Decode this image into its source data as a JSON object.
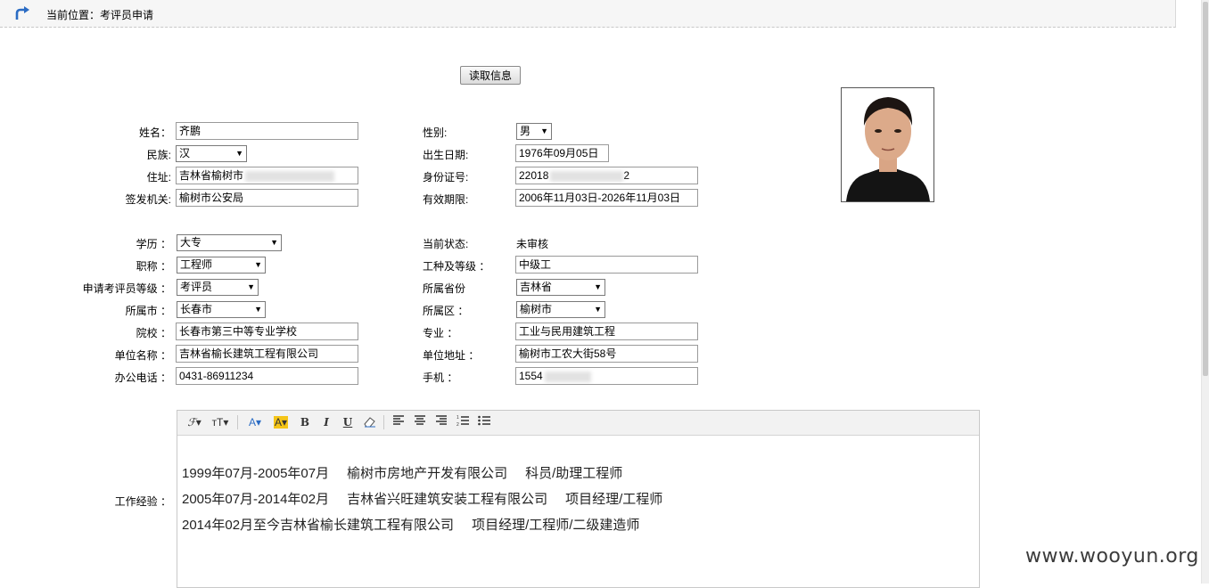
{
  "breadcrumb": {
    "text": "当前位置：考评员申请"
  },
  "read_button": {
    "label": "读取信息"
  },
  "identity": {
    "name_label": "姓名：",
    "name_value": "齐鹏",
    "gender_label": "性别:",
    "gender_value": "男",
    "ethnicity_label": "民族:",
    "ethnicity_value": "汉",
    "birth_label": "出生日期:",
    "birth_value": "1976年09月05日",
    "address_label": "住址:",
    "address_value": "吉林省榆树市",
    "idnum_label": "身份证号:",
    "idnum_prefix": "22018",
    "idnum_suffix": "2",
    "issuer_label": "签发机关:",
    "issuer_value": "榆树市公安局",
    "validity_label": "有效期限:",
    "validity_value": "2006年11月03日-2026年11月03日"
  },
  "profile": {
    "education_label": "学历 ：",
    "education_value": "大专",
    "status_label": "当前状态:",
    "status_value": "未审核",
    "title_label": "职称 ：",
    "title_value": "工程师",
    "worktype_label": "工种及等级 ：",
    "worktype_value": "中级工",
    "level_label": "申请考评员等级 ：",
    "level_value": "考评员",
    "province_label": "所属省份",
    "province_value": "吉林省",
    "city_label": "所属市 ：",
    "city_value": "长春市",
    "district_label": "所属区 ：",
    "district_value": "榆树市",
    "school_label": "院校 ：",
    "school_value": "长春市第三中等专业学校",
    "major_label": "专业 ：",
    "major_value": "工业与民用建筑工程",
    "company_label": "单位名称 ：",
    "company_value": "吉林省榆长建筑工程有限公司",
    "company_addr_label": "单位地址 ：",
    "company_addr_value": "榆树市工农大街58号",
    "office_phone_label": "办公电话 ：",
    "office_phone_value": "0431-86911234",
    "mobile_label": "手机 ：",
    "mobile_prefix": "1554"
  },
  "experience": {
    "label": "工作经验 ：",
    "lines": [
      [
        "1999年07月-2005年07月",
        "榆树市房地产开发有限公司",
        "科员/助理工程师"
      ],
      [
        "2005年07月-2014年02月",
        "吉林省兴旺建筑安装工程有限公司",
        "项目经理/工程师"
      ],
      [
        "2014年02月至今吉林省榆长建筑工程有限公司",
        "项目经理/工程师/二级建造师",
        ""
      ]
    ]
  },
  "toolbar": {
    "font_family": "ℱ▾",
    "font_size": "тT▾",
    "font_color": "A▾",
    "highlight": "A▾",
    "bold": "B",
    "italic": "I",
    "underline": "U"
  },
  "watermark": "www.wooyun.org",
  "colors": {
    "accent": "#2b6cc4",
    "highlight": "#f5c518"
  }
}
